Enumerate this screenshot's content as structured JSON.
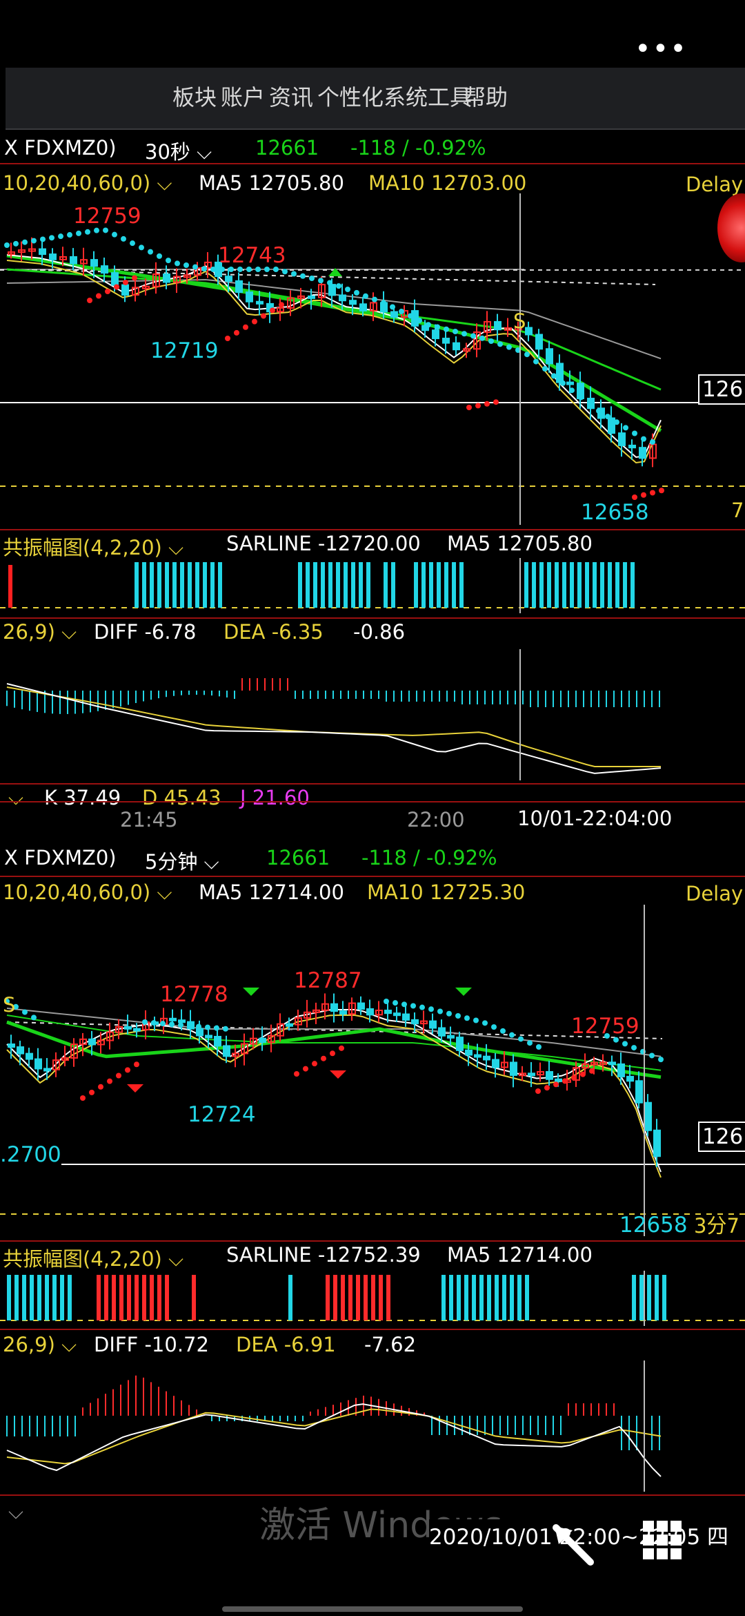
{
  "top_menu": {
    "more": "•••",
    "items": [
      "板块",
      "账户",
      "资讯",
      "个性化",
      "系统工具",
      "帮助"
    ]
  },
  "panel1": {
    "contract": "X FDXMZ0)",
    "period": "30秒",
    "price": "12661",
    "change": "-118 / -0.92%",
    "ma_params": "10,20,40,60,0)",
    "ma5": "MA5 12705.80",
    "ma10": "MA10 12703.00",
    "delay": "Delay",
    "price_right": "126",
    "price_right_bottom": "7",
    "hi_label": "12759",
    "mid_label": "12743",
    "lo1": "12719",
    "lo2": "12658",
    "s_marker": "S",
    "ind_name": "共振幅图(4,2,20)",
    "sarline": "SARLINE -12720.00",
    "ind_ma5": "MA5 12705.80",
    "macd_param": "26,9)",
    "diff": "DIFF -6.78",
    "dea": "DEA -6.35",
    "macd": "-0.86",
    "k": "K 37.49",
    "d": "D 45.43",
    "j": "J 21.60",
    "time1": "21:45",
    "time2": "22:00",
    "cursor_time": "10/01-22:04:00"
  },
  "panel2": {
    "contract": "X FDXMZ0)",
    "period": "5分钟",
    "price": "12661",
    "change": "-118 / -0.92%",
    "ma_params": "10,20,40,60,0)",
    "ma5": "MA5 12714.00",
    "ma10": "MA10 12725.30",
    "delay": "Delay",
    "price_right": "126",
    "left_level": "2700",
    "h1": "12778",
    "h2": "12787",
    "h3": "12759",
    "l1": "12724",
    "l2": "12658",
    "s_marker": "S",
    "side_label": "3分7",
    "ind_name": "共振幅图(4,2,20)",
    "sarline": "SARLINE -12752.39",
    "ind_ma5": "MA5 12714.00",
    "macd_param": "26,9)",
    "diff": "DIFF -10.72",
    "dea": "DEA -6.91",
    "macd": "-7.62",
    "watermark": "激活 Windows",
    "bottom_time": "2020/10/01 22:00~22:05 四"
  },
  "colors": {
    "bull": "#ff2b2b",
    "bear": "#22d6e6",
    "ma_yellow": "#e8d23a",
    "ma_green": "#19d419",
    "sar_cyan": "#22d6e6",
    "sar_red": "#ff2020",
    "separator": "#9a1010"
  }
}
